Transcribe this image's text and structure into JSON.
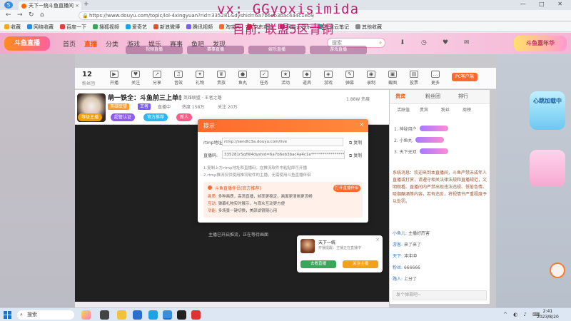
{
  "browser": {
    "tab_title": "天下一统斗鱼直播间",
    "url": "https://www.douyu.com/topic/lol-4xingyuan?rid=335281&dyshid=6a7b6eb3bac4a4c1eb9c7f9d84a2fb0c&da=",
    "bookmarks": [
      "收藏",
      "网络收藏",
      "百度一下",
      "搜狐视频",
      "爱奇艺",
      "新浪微博",
      "腾讯视频",
      "淘宝网",
      "京东商城",
      "网易云音乐",
      "有道云笔记",
      "其他收藏"
    ]
  },
  "overlay": {
    "line1": "vx: GGyoxisimida",
    "line2": "目前: 联盟5区青铜"
  },
  "site": {
    "logo": "斗鱼直播",
    "nav": [
      "首页",
      "直播",
      "分类",
      "游戏",
      "娱乐",
      "赛事",
      "鱼吧",
      "发现"
    ],
    "active_nav_index": 1,
    "search_placeholder": "搜索",
    "promo": "斗鱼嘉年华",
    "header_icons": [
      "下载",
      "历史",
      "关注",
      "消息"
    ],
    "banner_thumbs": [
      "视频直播",
      "赛事直播",
      "娱乐直播",
      "游戏直播"
    ]
  },
  "toolbar": {
    "count": "12",
    "sub": "粉丝团",
    "items": [
      "开播",
      "关注",
      "分享",
      "音效",
      "礼物",
      "贵族",
      "鱼丸",
      "任务",
      "活动",
      "道具",
      "游戏",
      "弹幕",
      "录制",
      "截图",
      "投票",
      "更多"
    ],
    "right_button": "PC客户端"
  },
  "room": {
    "title": "萌一铁全：斗鱼前三上单！",
    "meta": "分类 英雄联盟 · 王者之路",
    "tags": [
      "英雄联盟",
      "王者"
    ],
    "stats": [
      "直播中",
      "热度 158万",
      "关注 20万"
    ],
    "badges": [
      "等级主播",
      "超管认证",
      "官方推荐",
      "新人"
    ],
    "right_info": "1.88W 热度"
  },
  "dialog": {
    "title": "提示",
    "close": "×",
    "rtmp_label": "rtmp地址:",
    "rtmp_value": "rtmp://sendtc3a.douyu.com/live",
    "key_label": "直播码:",
    "key_value": "335281rSqfW4dyshid=6a7b6eb3bac4a4c1e*******************k6eb=20bdcmp_id",
    "copy_label": "复制",
    "note1": "1.复制上方rtmp地址和直播码，在推流软件中粘贴即可开播",
    "note2": "2.rtmp推流仅供使用推流软件的主播，无需使用斗鱼直播伴侣",
    "ad_title": "斗鱼直播伴侣(官方推荐)",
    "ad_button": "打开直播伴侣",
    "ad_lines": [
      {
        "k": "画质:",
        "v": "多种画质，高清直播，帧率更稳定，画面更清晰更流畅"
      },
      {
        "k": "互动:",
        "v": "弹幕礼物实时展示，与观众互动更方便"
      },
      {
        "k": "功能:",
        "v": "多场景一键切换，美颜滤镜随心用"
      }
    ]
  },
  "under_video": "主播已开启推流，正在等待画面",
  "popup2": {
    "name": "天下一统",
    "desc": "开播提醒：主播正在直播中",
    "btn_left": "去看直播",
    "btn_right": "关注主播",
    "close": "×"
  },
  "rpanel": {
    "tabs": [
      "贵宾",
      "粉丝团",
      "排行"
    ],
    "active_tab": 0,
    "sub_tabs": [
      "活跃值",
      "贵宾",
      "粉丝",
      "周榜"
    ],
    "ranks": [
      "1. 神秘用户",
      "2. 小鱼丸",
      "3. 天下无双"
    ],
    "chat_block": "系统消息：欢迎来到本直播间，斗鱼严禁未成年人直播或打赏，请遵守相关法律法规和直播规范，文明观看。直播间内严禁出现违法违规、低俗色情、吸烟酗酒等内容，若有违反，将视情节严重程度予以处罚。",
    "chat_lines": [
      {
        "user": "小鱼儿:",
        "text": "主播好厉害"
      },
      {
        "user": "游客:",
        "text": "来了来了"
      },
      {
        "user": "天下:",
        "text": "冲冲冲"
      },
      {
        "user": "粉丝:",
        "text": "666666"
      },
      {
        "user": "路人:",
        "text": "上分了"
      }
    ],
    "chat_placeholder": "发个弹幕吧~"
  },
  "right_deco": "心跳加载中",
  "taskbar": {
    "search": "搜索",
    "time": "2:41",
    "date": "2023/8/20"
  }
}
